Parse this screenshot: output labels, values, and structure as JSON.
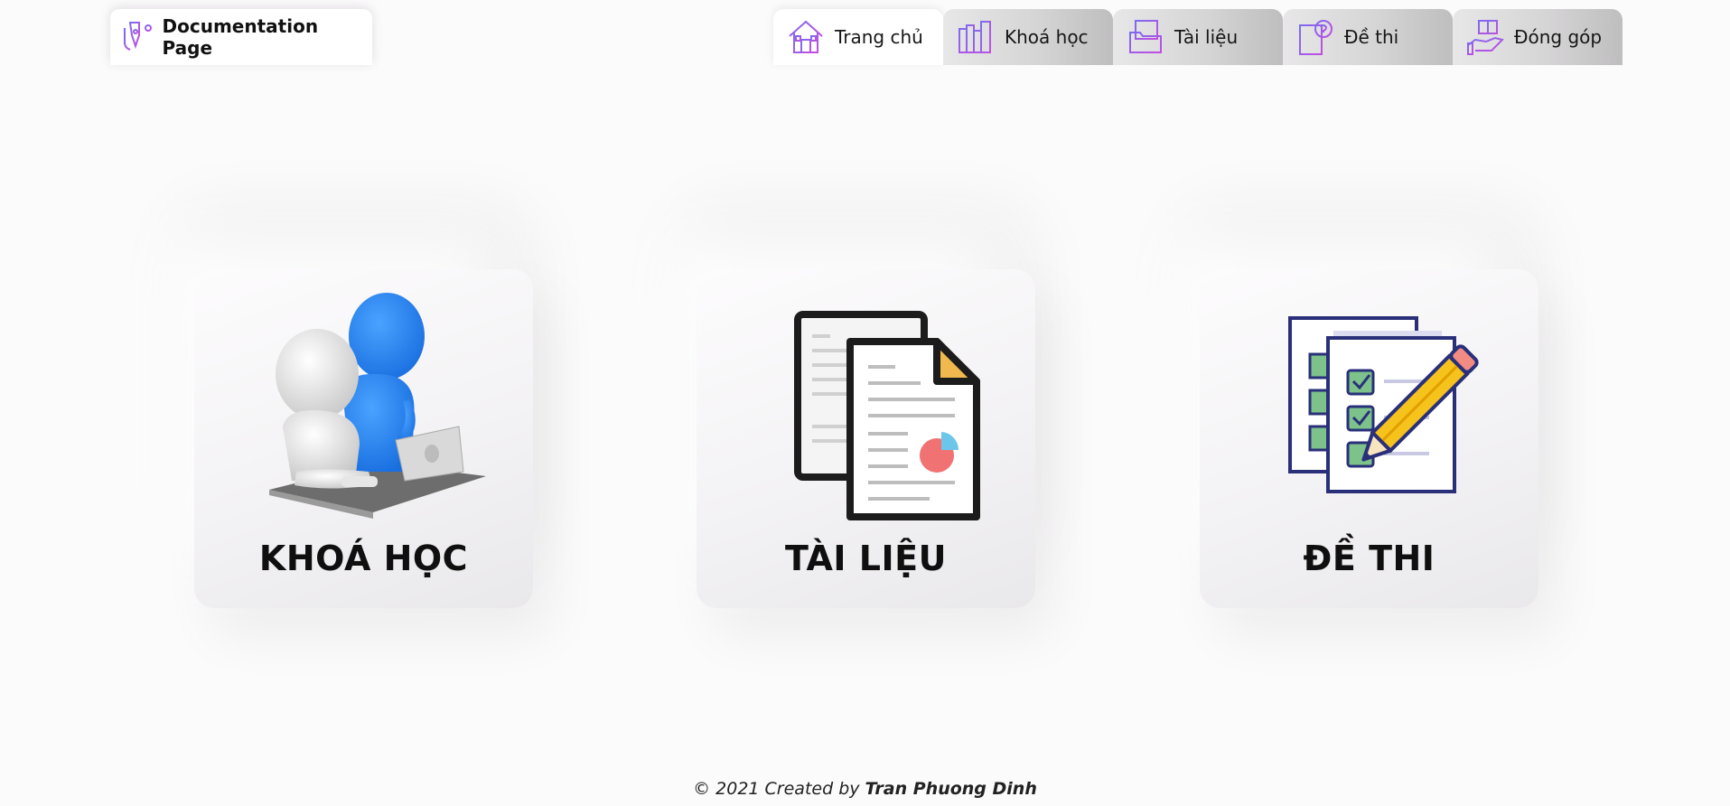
{
  "header": {
    "brand": {
      "title": "Documentation Page",
      "icon": "pen-tool-icon"
    },
    "nav": [
      {
        "label": "Trang chủ",
        "icon": "home-icon",
        "active": true
      },
      {
        "label": "Khoá học",
        "icon": "books-icon",
        "active": false
      },
      {
        "label": "Tài liệu",
        "icon": "folder-documents-icon",
        "active": false
      },
      {
        "label": "Đề thi",
        "icon": "exam-question-icon",
        "active": false
      },
      {
        "label": "Đóng góp",
        "icon": "hand-contribute-icon",
        "active": false
      }
    ]
  },
  "cards": [
    {
      "title": "KHOÁ HỌC",
      "image": "teacher-student-laptop-illustration"
    },
    {
      "title": "TÀI LIỆU",
      "image": "documents-pie-chart-illustration"
    },
    {
      "title": "ĐỀ THI",
      "image": "checklist-pencil-illustration"
    }
  ],
  "footer": {
    "prefix": "© 2021 Created by ",
    "author": "Tran Phuong Dinh"
  },
  "colors": {
    "background": "#fcfbfc",
    "icon_gradient_start": "#7b6cf0",
    "icon_gradient_end": "#c24ee0",
    "tab_inactive": "#d6d5d6",
    "tab_active": "#ffffff"
  }
}
